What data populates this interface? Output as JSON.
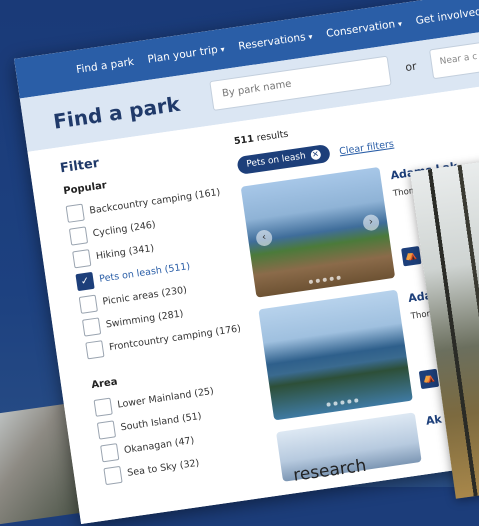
{
  "nav": {
    "items": [
      {
        "label": "Find a park",
        "dropdown": false
      },
      {
        "label": "Plan your trip",
        "dropdown": true
      },
      {
        "label": "Reservations",
        "dropdown": true
      },
      {
        "label": "Conservation",
        "dropdown": true
      },
      {
        "label": "Get involved",
        "dropdown": true
      }
    ]
  },
  "search": {
    "title": "Find a park",
    "placeholder": "By park name",
    "or_label": "or",
    "near_placeholder": "Near a c"
  },
  "filter": {
    "title": "Filter",
    "popular_title": "Popular",
    "popular": [
      {
        "label": "Backcountry camping (161)",
        "checked": false
      },
      {
        "label": "Cycling (246)",
        "checked": false
      },
      {
        "label": "Hiking (341)",
        "checked": false
      },
      {
        "label": "Pets on leash (511)",
        "checked": true
      },
      {
        "label": "Picnic areas (230)",
        "checked": false
      },
      {
        "label": "Swimming (281)",
        "checked": false
      },
      {
        "label": "Frontcountry camping (176)",
        "checked": false
      }
    ],
    "area_title": "Area",
    "area": [
      {
        "label": "Lower Mainland (25)",
        "checked": false
      },
      {
        "label": "South Island (51)",
        "checked": false
      },
      {
        "label": "Okanagan (47)",
        "checked": false
      },
      {
        "label": "Sea to Sky (32)",
        "checked": false
      }
    ]
  },
  "results": {
    "count": "511",
    "count_suffix": "results",
    "active_chip": "Pets on leash",
    "clear_label": "Clear filters",
    "items": [
      {
        "name": "Adams Lak",
        "region": "Thompson"
      },
      {
        "name": "Adams",
        "region": "Thomps"
      },
      {
        "name": "Ak",
        "region": ""
      }
    ]
  },
  "caption": "research"
}
